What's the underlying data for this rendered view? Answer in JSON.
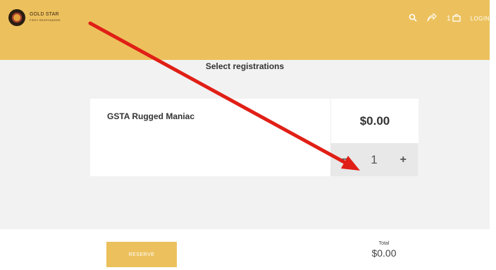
{
  "header": {
    "logo_text": "GOLD STAR",
    "logo_subtext": "FIRST RESPONDERS",
    "cart_count": "1",
    "login_label": "LOGIN"
  },
  "main": {
    "title": "Select registrations",
    "registration": {
      "name": "GSTA Rugged Maniac",
      "price": "$0.00",
      "quantity": "1",
      "minus": "−",
      "plus": "+"
    }
  },
  "footer": {
    "reserve_label": "RESERVE",
    "total_label": "Total",
    "total_value": "$0.00"
  },
  "colors": {
    "header_bg": "#ecc15d",
    "arrow": "#e01f16"
  },
  "icons": {
    "search": "search-icon",
    "share": "share-icon",
    "cart": "cart-icon",
    "arrow": "annotation-arrow"
  }
}
